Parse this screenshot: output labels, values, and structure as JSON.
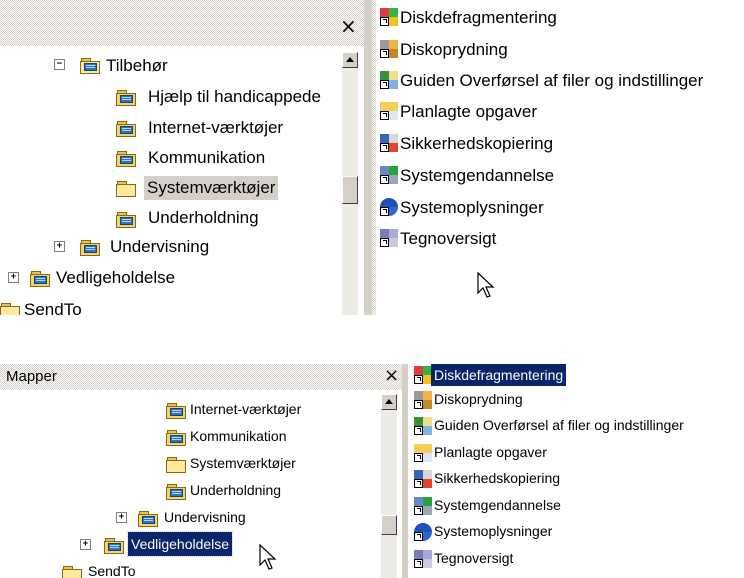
{
  "top": {
    "close_glyph": "×",
    "tree": [
      {
        "label": "Tilbehør",
        "expander": "−"
      },
      {
        "label": "Hjælp til handicappede"
      },
      {
        "label": "Internet-værktøjer"
      },
      {
        "label": "Kommunikation"
      },
      {
        "label": "Systemværktøjer"
      },
      {
        "label": "Underholdning"
      },
      {
        "label": "Undervisning",
        "expander": "+"
      },
      {
        "label": "Vedligeholdelse",
        "expander": "+"
      },
      {
        "label": "SendTo"
      }
    ],
    "items": [
      {
        "label": "Diskdefragmentering",
        "icon": "disk-defragmenter-icon"
      },
      {
        "label": "Diskoprydning",
        "icon": "disk-cleanup-icon"
      },
      {
        "label": "Guiden Overførsel af filer og indstillinger",
        "icon": "transfer-wizard-icon"
      },
      {
        "label": "Planlagte opgaver",
        "icon": "scheduled-tasks-icon"
      },
      {
        "label": "Sikkerhedskopiering",
        "icon": "backup-icon"
      },
      {
        "label": "Systemgendannelse",
        "icon": "system-restore-icon"
      },
      {
        "label": "Systemoplysninger",
        "icon": "system-information-icon"
      },
      {
        "label": "Tegnoversigt",
        "icon": "character-map-icon"
      }
    ]
  },
  "bottom": {
    "pane_title": "Mapper",
    "close_glyph": "×",
    "tree": [
      {
        "label": "Internet-værktøjer"
      },
      {
        "label": "Kommunikation"
      },
      {
        "label": "Systemværktøjer"
      },
      {
        "label": "Underholdning"
      },
      {
        "label": "Undervisning",
        "expander": "+"
      },
      {
        "label": "Vedligeholdelse",
        "expander": "+"
      },
      {
        "label": "SendTo"
      }
    ],
    "items": [
      {
        "label": "Diskdefragmentering",
        "icon": "disk-defragmenter-icon"
      },
      {
        "label": "Diskoprydning",
        "icon": "disk-cleanup-icon"
      },
      {
        "label": "Guiden Overførsel af filer og indstillinger",
        "icon": "transfer-wizard-icon"
      },
      {
        "label": "Planlagte opgaver",
        "icon": "scheduled-tasks-icon"
      },
      {
        "label": "Sikkerhedskopiering",
        "icon": "backup-icon"
      },
      {
        "label": "Systemgendannelse",
        "icon": "system-restore-icon"
      },
      {
        "label": "Systemoplysninger",
        "icon": "system-information-icon"
      },
      {
        "label": "Tegnoversigt",
        "icon": "character-map-icon"
      }
    ]
  },
  "colors": {
    "selection_blue": "#0a246a",
    "inactive_selection": "#d4d0c8",
    "panel_gray": "#d4d0c8"
  }
}
